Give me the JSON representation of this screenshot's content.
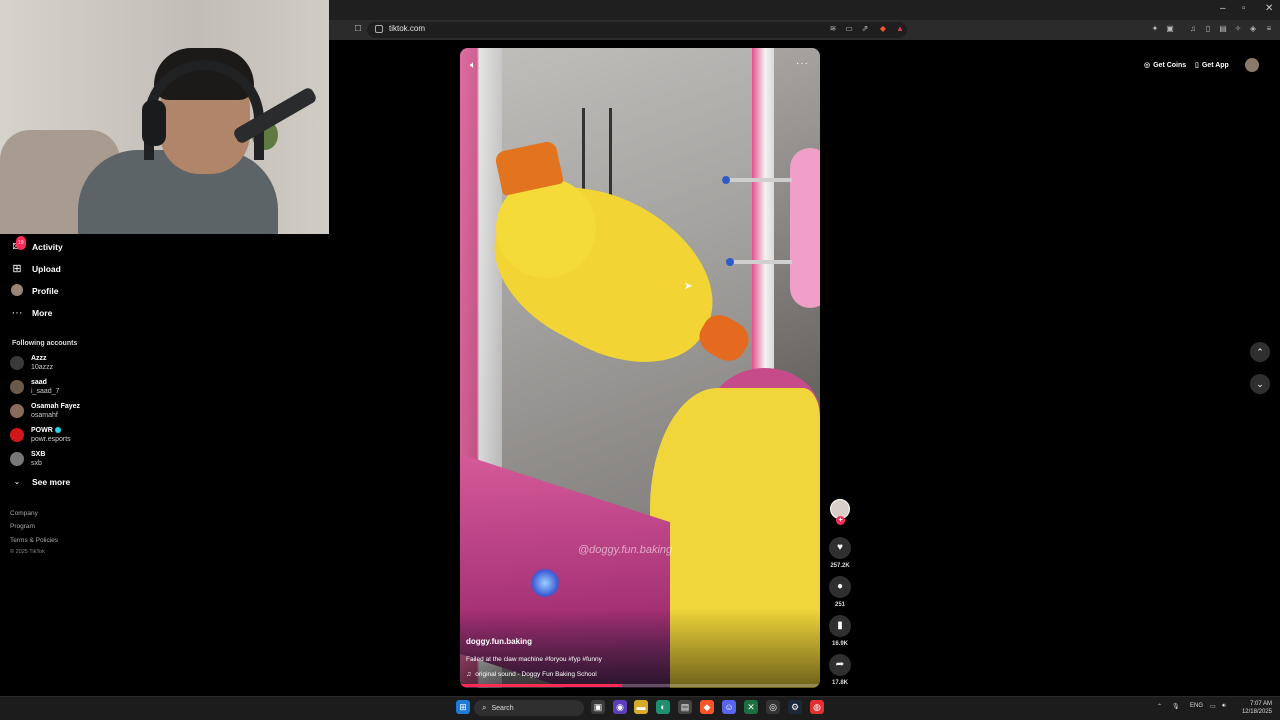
{
  "browser": {
    "url": "tiktok.com",
    "window_controls": [
      "–",
      "▫",
      "✕"
    ]
  },
  "sidebar": {
    "activity_badge": "19",
    "items": [
      {
        "label": "Activity",
        "icon": "activity-icon"
      },
      {
        "label": "Upload",
        "icon": "upload-icon"
      },
      {
        "label": "Profile",
        "icon": "profile-avatar"
      },
      {
        "label": "More",
        "icon": "more-icon"
      }
    ],
    "following_header": "Following accounts",
    "accounts": [
      {
        "name": "Azzz",
        "handle": "10azzz",
        "color": "#3a3a3a"
      },
      {
        "name": "saad",
        "handle": "i_saad_7",
        "color": "#6b5a4a"
      },
      {
        "name": "Osamah Fayez",
        "handle": "osamahf",
        "color": "#8a6a5a"
      },
      {
        "name": "POWR",
        "handle": "powr.esports",
        "color": "#d01818",
        "verified": true
      },
      {
        "name": "SXB",
        "handle": "sxb",
        "color": "#777777"
      }
    ],
    "see_more": "See more",
    "footer_links": [
      "Company",
      "Program",
      "Terms & Policies"
    ],
    "copyright": "© 2025 TikTok"
  },
  "header": {
    "get_coins": "Get Coins",
    "get_app": "Get App"
  },
  "video": {
    "username": "doggy.fun.baking",
    "caption": "Failed at the claw machine #foryou #fyp #funny",
    "sound": "original sound - Doggy Fun Baking School",
    "watermark": "@doggy.fun.baking",
    "progress": 0.45
  },
  "actions": {
    "likes": "257.2K",
    "comments": "251",
    "saves": "16.9K",
    "shares": "17.8K"
  },
  "taskbar": {
    "search_placeholder": "Search",
    "language": "ENG",
    "time": "7:07 AM",
    "date": "12/18/2025"
  },
  "colors": {
    "accent": "#fe2c55",
    "verified": "#20d5ec",
    "background": "#000000"
  }
}
